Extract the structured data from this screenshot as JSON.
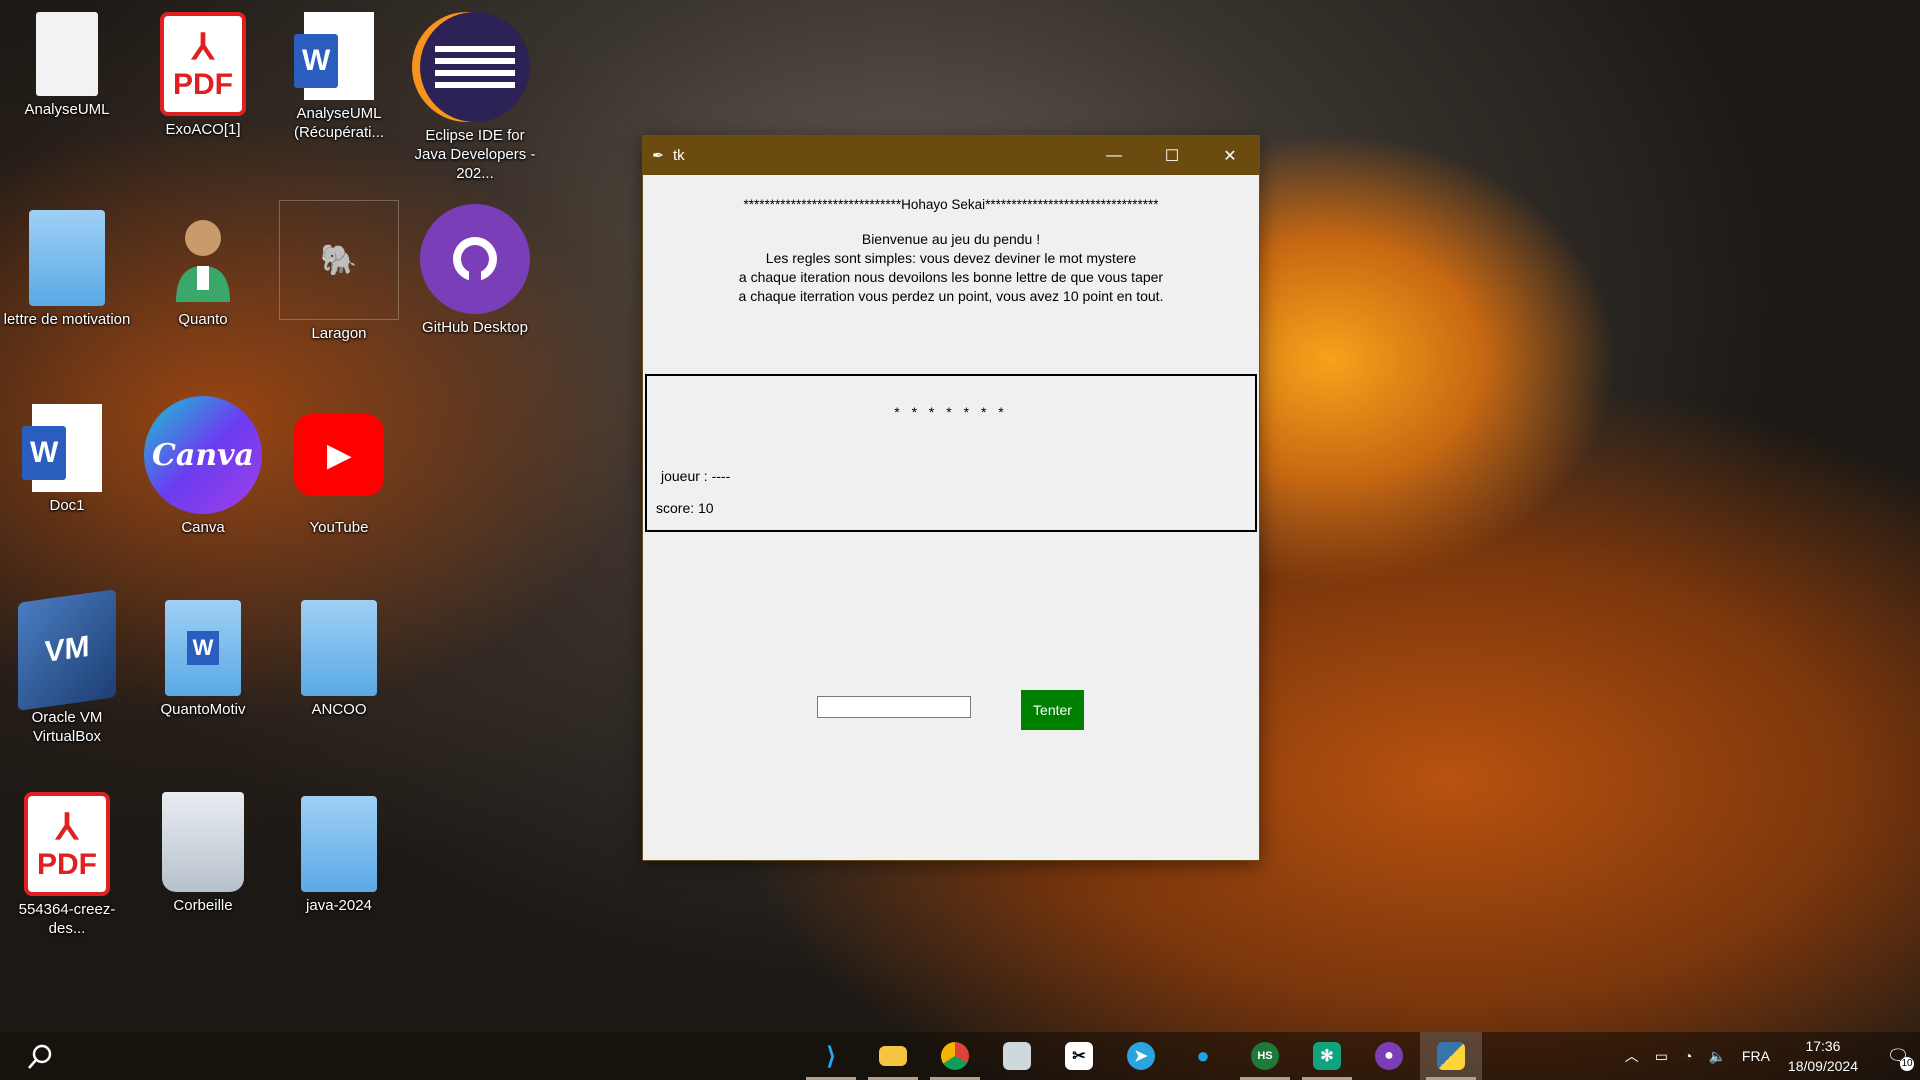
{
  "desktop": {
    "icons": [
      {
        "label": "AnalyseUML",
        "icon": "document-icon"
      },
      {
        "label": "ExoACO[1]",
        "icon": "pdf-icon",
        "glyph": "PDF"
      },
      {
        "label": "AnalyseUML (Récupérati...",
        "icon": "word-icon",
        "glyph": "W"
      },
      {
        "label": "Eclipse IDE for Java Developers - 202...",
        "icon": "eclipse-icon"
      },
      {
        "label": "lettre de motivation",
        "icon": "folder-icon"
      },
      {
        "label": "Quanto",
        "icon": "person-icon"
      },
      {
        "label": "Laragon",
        "icon": "elephant-icon"
      },
      {
        "label": "GitHub Desktop",
        "icon": "github-icon"
      },
      {
        "label": "Doc1",
        "icon": "word-icon",
        "glyph": "W"
      },
      {
        "label": "Canva",
        "icon": "canva-icon",
        "glyph": "Canva"
      },
      {
        "label": "YouTube",
        "icon": "youtube-icon"
      },
      {
        "label": "Oracle VM VirtualBox",
        "icon": "virtualbox-icon"
      },
      {
        "label": "QuantoMotiv",
        "icon": "word-folder-icon",
        "glyph": "W"
      },
      {
        "label": "ANCOO",
        "icon": "folder-icon"
      },
      {
        "label": "554364-creez-des...",
        "icon": "pdf-icon",
        "glyph": "PDF"
      },
      {
        "label": "Corbeille",
        "icon": "recycle-bin-icon"
      },
      {
        "label": "java-2024",
        "icon": "folder-icon"
      }
    ]
  },
  "window": {
    "title": "tk",
    "header": "******************************Hohayo Sekai*********************************",
    "rules": [
      "Bienvenue au jeu du pendu !",
      "Les regles sont simples: vous devez deviner le mot mystere",
      "a chaque iteration nous devoilons les bonne lettre de que vous taper",
      "a chaque iterration vous perdez un point, vous avez 10 point en tout."
    ],
    "masked_word": "* * * * * * *",
    "player": "joueur : ----",
    "score": "score: 10",
    "guess_value": "",
    "try_label": "Tenter",
    "try_color": "#008000",
    "title_color": "#6b4b0f"
  },
  "taskbar": {
    "apps": [
      "vscode-icon",
      "file-explorer-icon",
      "chrome-icon",
      "photos-icon",
      "capcut-icon",
      "telegram-icon",
      "laragon-icon",
      "hs-icon",
      "chatgpt-icon",
      "github-desktop-icon",
      "python-icon"
    ],
    "language": "FRA",
    "time": "17:36",
    "date": "18/09/2024",
    "notification_count": "10"
  }
}
